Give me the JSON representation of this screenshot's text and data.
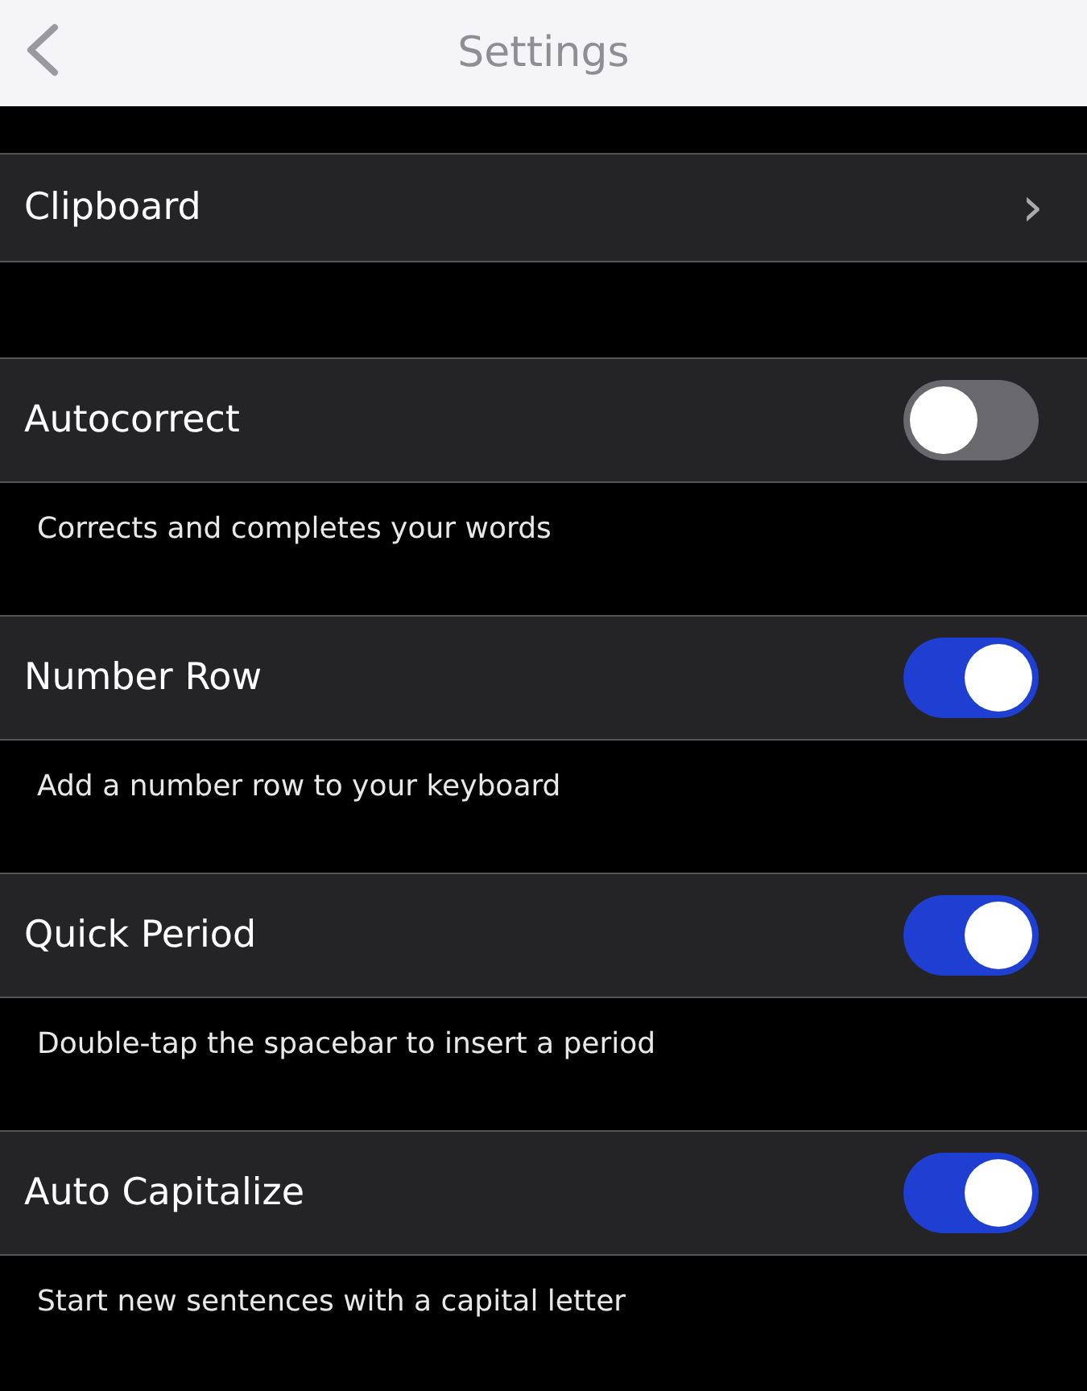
{
  "header": {
    "title": "Settings"
  },
  "sections": [
    {
      "kind": "link",
      "label": "Clipboard",
      "chevron": "›"
    },
    {
      "kind": "toggle",
      "label": "Autocorrect",
      "on": false,
      "description": "Corrects and completes your words"
    },
    {
      "kind": "toggle",
      "label": "Number Row",
      "on": true,
      "description": "Add a number row to your keyboard"
    },
    {
      "kind": "toggle",
      "label": "Quick Period",
      "on": true,
      "description": "Double-tap the spacebar to insert a period"
    },
    {
      "kind": "toggle",
      "label": "Auto Capitalize",
      "on": true,
      "description": "Start new sentences with a capital letter"
    }
  ]
}
